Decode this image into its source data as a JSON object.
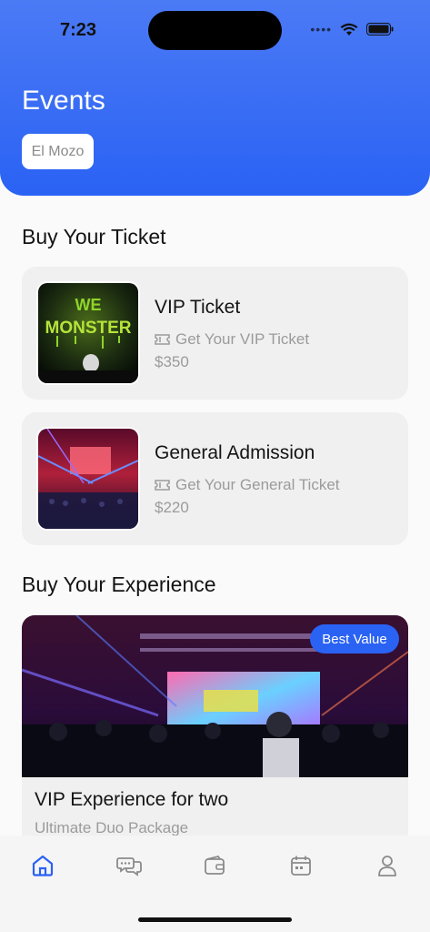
{
  "status_bar": {
    "time": "7:23",
    "signal_dots": "••••"
  },
  "header": {
    "title": "Events",
    "venue_chip": "El Mozo"
  },
  "tickets_section": {
    "title": "Buy Your Ticket",
    "items": [
      {
        "name": "VIP Ticket",
        "subtitle": "Get Your VIP Ticket",
        "price": "$350",
        "poster_text_1": "WE",
        "poster_text_2": "MONSTER"
      },
      {
        "name": "General Admission",
        "subtitle": "Get Your General Ticket",
        "price": "$220"
      }
    ]
  },
  "experience_section": {
    "title": "Buy Your Experience",
    "card": {
      "badge": "Best Value",
      "title": "VIP Experience for two",
      "subtitle": "Ultimate Duo Package"
    }
  },
  "tabbar": {
    "items": [
      "home-icon",
      "chat-icon",
      "wallet-icon",
      "calendar-icon",
      "profile-icon"
    ],
    "active_color": "#2a62f4",
    "inactive_color": "#8a8a8a"
  },
  "colors": {
    "accent": "#2a62f4",
    "header_top": "#4b7af5"
  }
}
